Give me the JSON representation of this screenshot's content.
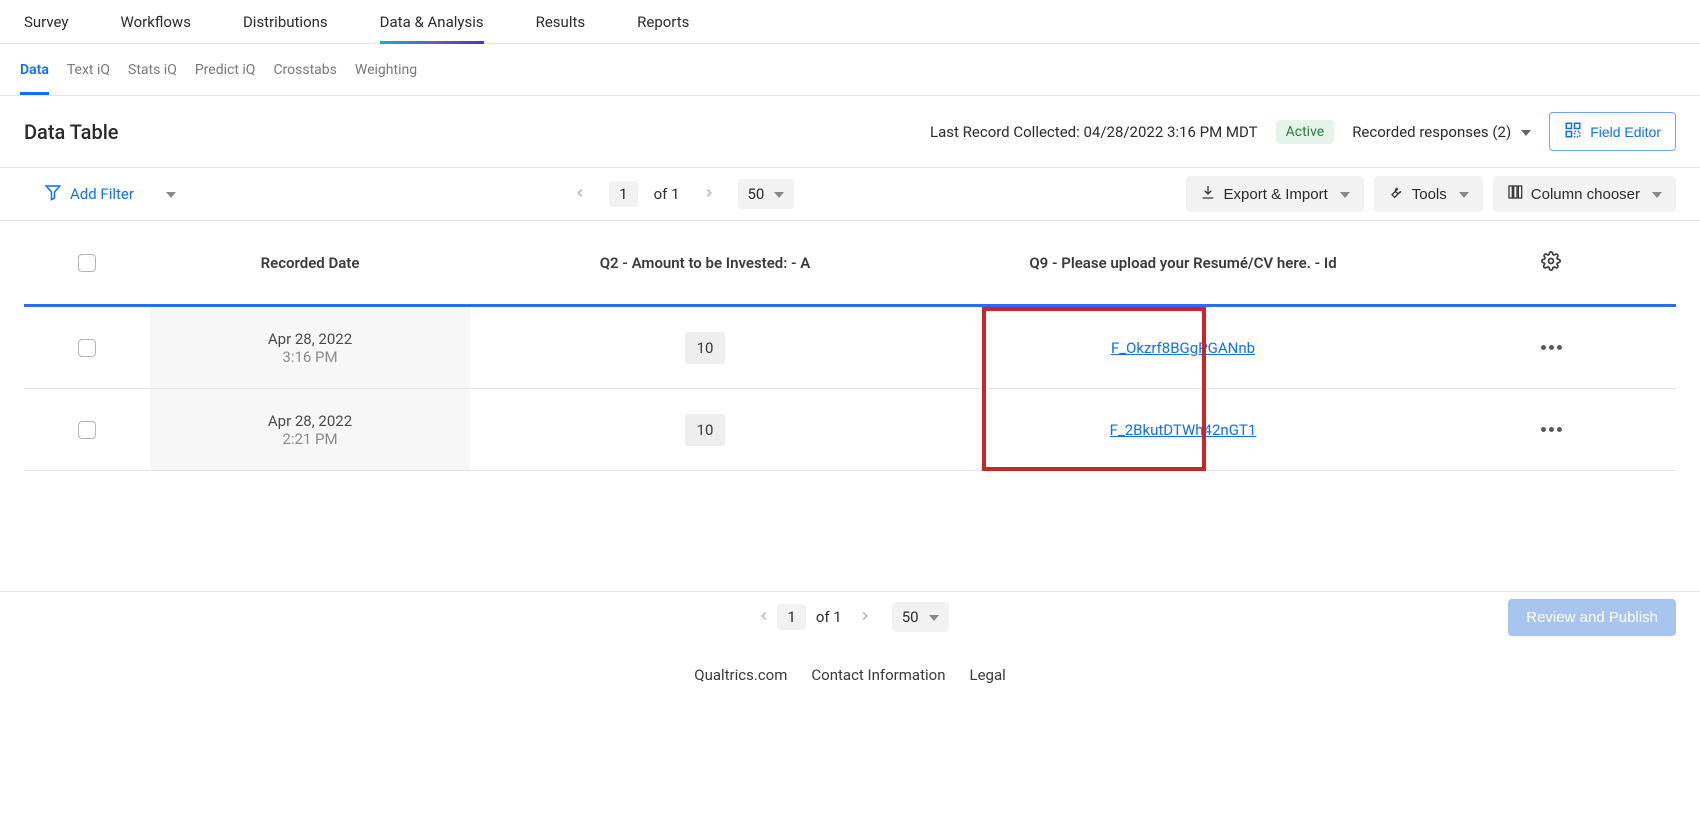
{
  "top_tabs": [
    "Survey",
    "Workflows",
    "Distributions",
    "Data & Analysis",
    "Results",
    "Reports"
  ],
  "top_tab_selected_index": 3,
  "sub_tabs": [
    "Data",
    "Text iQ",
    "Stats iQ",
    "Predict iQ",
    "Crosstabs",
    "Weighting"
  ],
  "sub_tab_selected_index": 0,
  "page_title": "Data Table",
  "last_record_label": "Last Record Collected: 04/28/2022 3:16 PM MDT",
  "status_badge": "Active",
  "recorded_label": "Recorded responses (2)",
  "field_editor_label": "Field Editor",
  "add_filter_label": "Add Filter",
  "pager": {
    "page": "1",
    "of_label": "of 1",
    "page_size": "50"
  },
  "export_import_label": "Export & Import",
  "tools_label": "Tools",
  "column_chooser_label": "Column chooser",
  "columns": {
    "recorded_date": "Recorded Date",
    "q2": "Q2 - Amount to be Invested: - A",
    "q9": "Q9 - Please upload your Resumé/CV here. - Id"
  },
  "rows": [
    {
      "date": "Apr 28, 2022",
      "time": "3:16 PM",
      "q2": "10",
      "q9": "F_Okzrf8BGgPGANnb"
    },
    {
      "date": "Apr 28, 2022",
      "time": "2:21 PM",
      "q2": "10",
      "q9": "F_2BkutDTWh42nGT1"
    }
  ],
  "review_publish_label": "Review and Publish",
  "footer_links": [
    "Qualtrics.com",
    "Contact Information",
    "Legal"
  ]
}
